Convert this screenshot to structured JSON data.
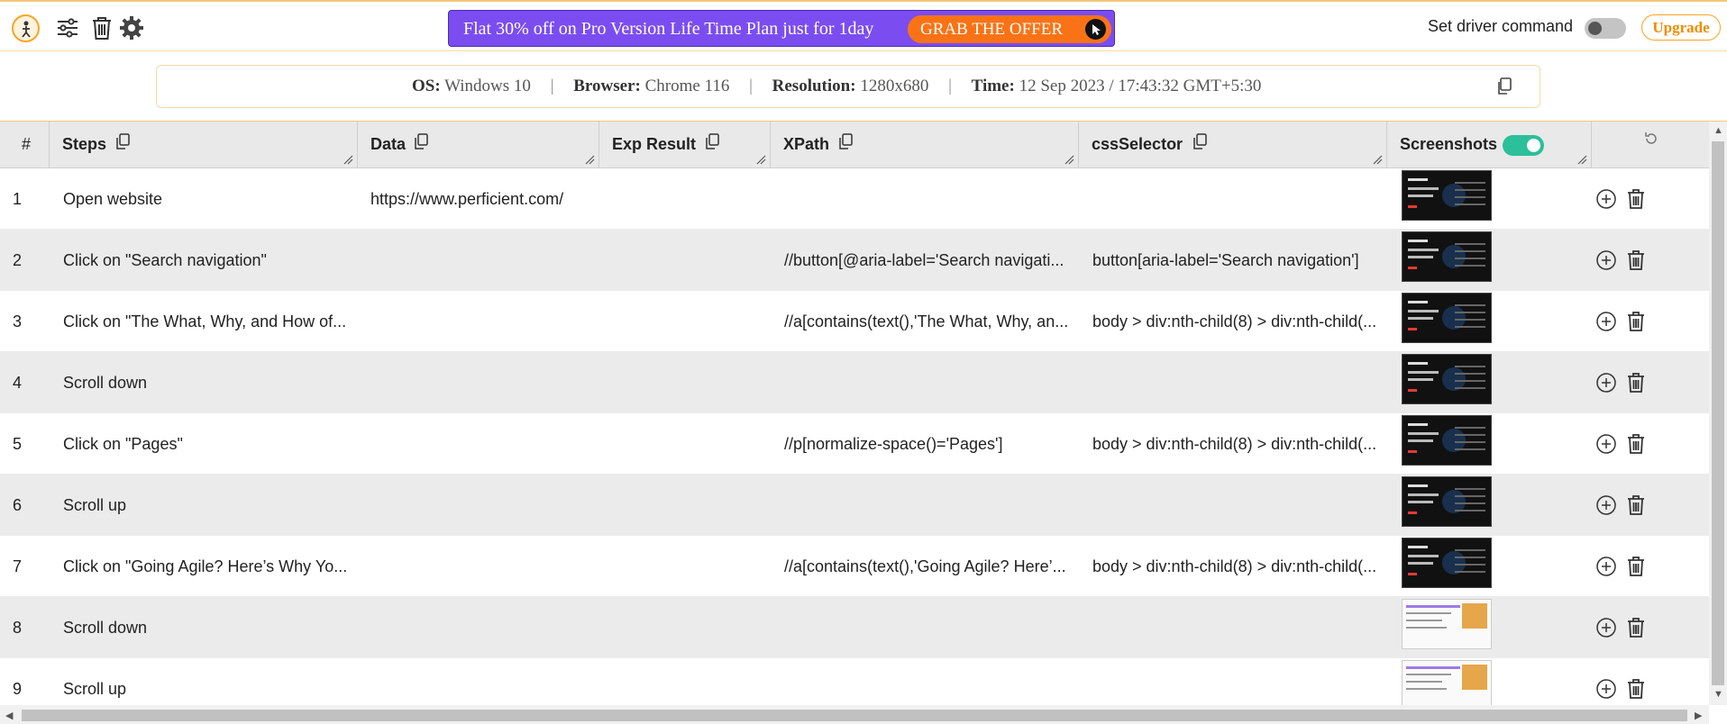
{
  "topbar": {
    "icons": [
      "app-logo-icon",
      "sliders-icon",
      "trash-icon",
      "settings-gear-icon"
    ],
    "banner": {
      "text": "Flat 30% off on Pro Version Life Time Plan just for 1day",
      "button_label": "GRAB THE OFFER"
    },
    "driver_command_label": "Set driver command",
    "driver_command_enabled": false,
    "upgrade_label": "Upgrade"
  },
  "info": {
    "os_label": "OS:",
    "os_value": "Windows 10",
    "browser_label": "Browser:",
    "browser_value": "Chrome 116",
    "resolution_label": "Resolution:",
    "resolution_value": "1280x680",
    "time_label": "Time:",
    "time_value": "12 Sep 2023 / 17:43:32 GMT+5:30",
    "separator": "|"
  },
  "table": {
    "headers": {
      "num": "#",
      "steps": "Steps",
      "data": "Data",
      "exp": "Exp Result",
      "xpath": "XPath",
      "css": "cssSelector",
      "screenshots": "Screenshots"
    },
    "screenshots_enabled": true,
    "rows": [
      {
        "num": "1",
        "step": "Open website",
        "data": "https://www.perficient.com/",
        "exp": "",
        "xpath": "",
        "css": "",
        "thumb": "dark"
      },
      {
        "num": "2",
        "step": "Click on \"Search navigation\"",
        "data": "",
        "exp": "",
        "xpath": "//button[@aria-label='Search navigati...",
        "css": "button[aria-label='Search navigation']",
        "thumb": "dark"
      },
      {
        "num": "3",
        "step": "Click on \"The What, Why, and How of...",
        "data": "",
        "exp": "",
        "xpath": "//a[contains(text(),'The What, Why, an...",
        "css": "body > div:nth-child(8) > div:nth-child(...",
        "thumb": "dark"
      },
      {
        "num": "4",
        "step": "Scroll down",
        "data": "",
        "exp": "",
        "xpath": "",
        "css": "",
        "thumb": "dark"
      },
      {
        "num": "5",
        "step": "Click on \"Pages\"",
        "data": "",
        "exp": "",
        "xpath": "//p[normalize-space()='Pages']",
        "css": "body > div:nth-child(8) > div:nth-child(...",
        "thumb": "dark"
      },
      {
        "num": "6",
        "step": "Scroll up",
        "data": "",
        "exp": "",
        "xpath": "",
        "css": "",
        "thumb": "dark"
      },
      {
        "num": "7",
        "step": "Click on \"Going Agile? Here’s Why Yo...",
        "data": "",
        "exp": "",
        "xpath": "//a[contains(text(),'Going Agile? Here’...",
        "css": "body > div:nth-child(8) > div:nth-child(...",
        "thumb": "dark"
      },
      {
        "num": "8",
        "step": "Scroll down",
        "data": "",
        "exp": "",
        "xpath": "",
        "css": "",
        "thumb": "light"
      },
      {
        "num": "9",
        "step": "Scroll up",
        "data": "",
        "exp": "",
        "xpath": "",
        "css": "",
        "thumb": "light"
      }
    ]
  },
  "colors": {
    "accent_orange": "#f5a623",
    "banner_purple": "#7b4df0",
    "offer_button": "#f97316",
    "toggle_on": "#2bbf9a"
  }
}
